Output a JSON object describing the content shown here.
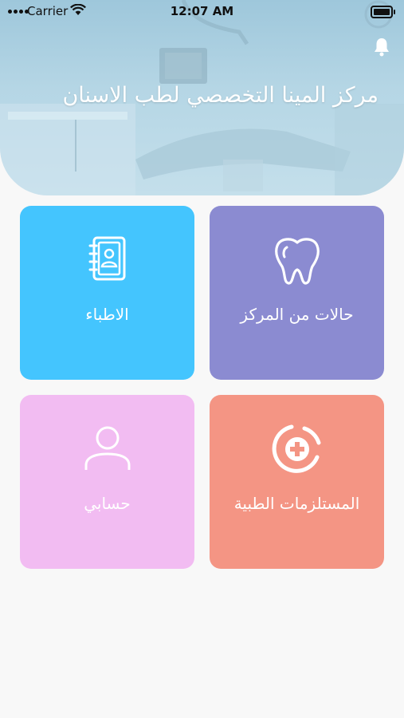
{
  "status_bar": {
    "carrier": "Carrier",
    "time": "12:07 AM"
  },
  "header": {
    "title": "مركز المينا التخصصي لطب الاسنان",
    "notification_icon": "bell-icon"
  },
  "tiles": [
    {
      "label": "حالات من المركز",
      "icon": "tooth-icon",
      "color": "#8b8bd1"
    },
    {
      "label": "الاطباء",
      "icon": "doctors-book-icon",
      "color": "#44c5fe"
    },
    {
      "label": "المستلزمات الطبية",
      "icon": "medical-cross-icon",
      "color": "#f49584"
    },
    {
      "label": "حسابي",
      "icon": "user-icon",
      "color": "#f2bcf2"
    }
  ]
}
